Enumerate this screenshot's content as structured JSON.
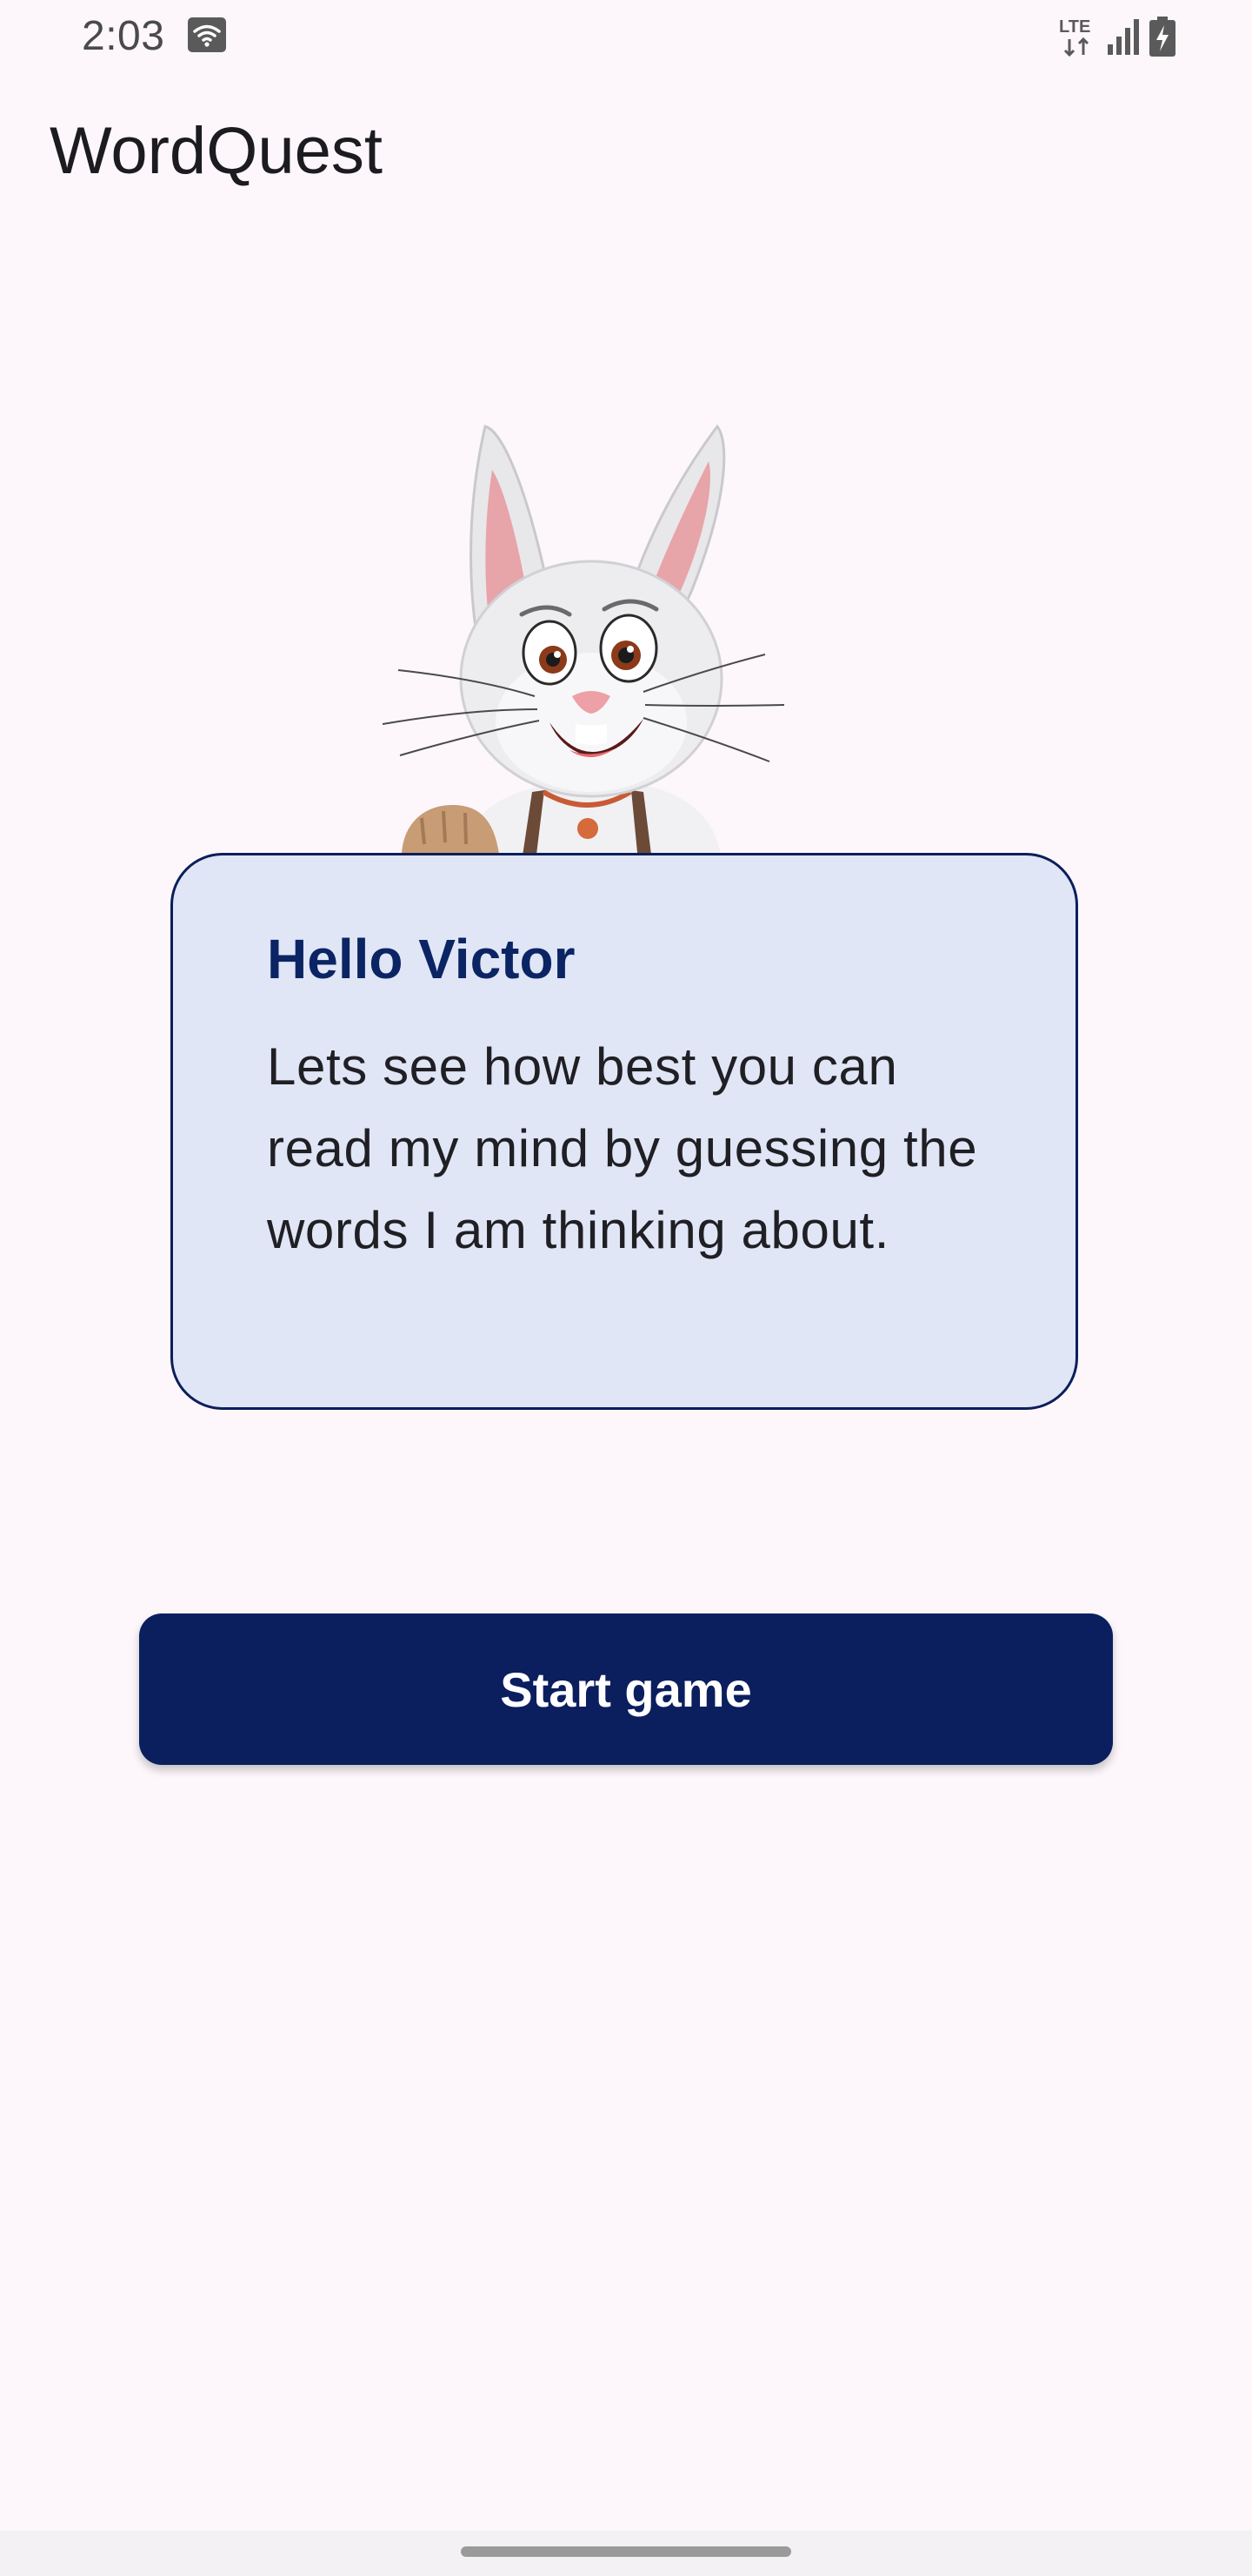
{
  "status_bar": {
    "time": "2:03",
    "network_label": "LTE",
    "icons": [
      "wifi-icon",
      "lte-icon",
      "signal-icon",
      "battery-charging-icon"
    ]
  },
  "app_bar": {
    "title": "WordQuest"
  },
  "mascot": {
    "icon": "bunny-mascot"
  },
  "card": {
    "title": "Hello Victor",
    "body": "Lets see how best you can read my mind by guessing the words I am thinking about."
  },
  "actions": {
    "start_label": "Start game"
  },
  "colors": {
    "background": "#fdf7fc",
    "card_background": "#e0e6f6",
    "card_border": "#0b1f5a",
    "title_accent": "#0b2463",
    "button_background": "#0b1f5f",
    "button_text": "#ffffff"
  }
}
